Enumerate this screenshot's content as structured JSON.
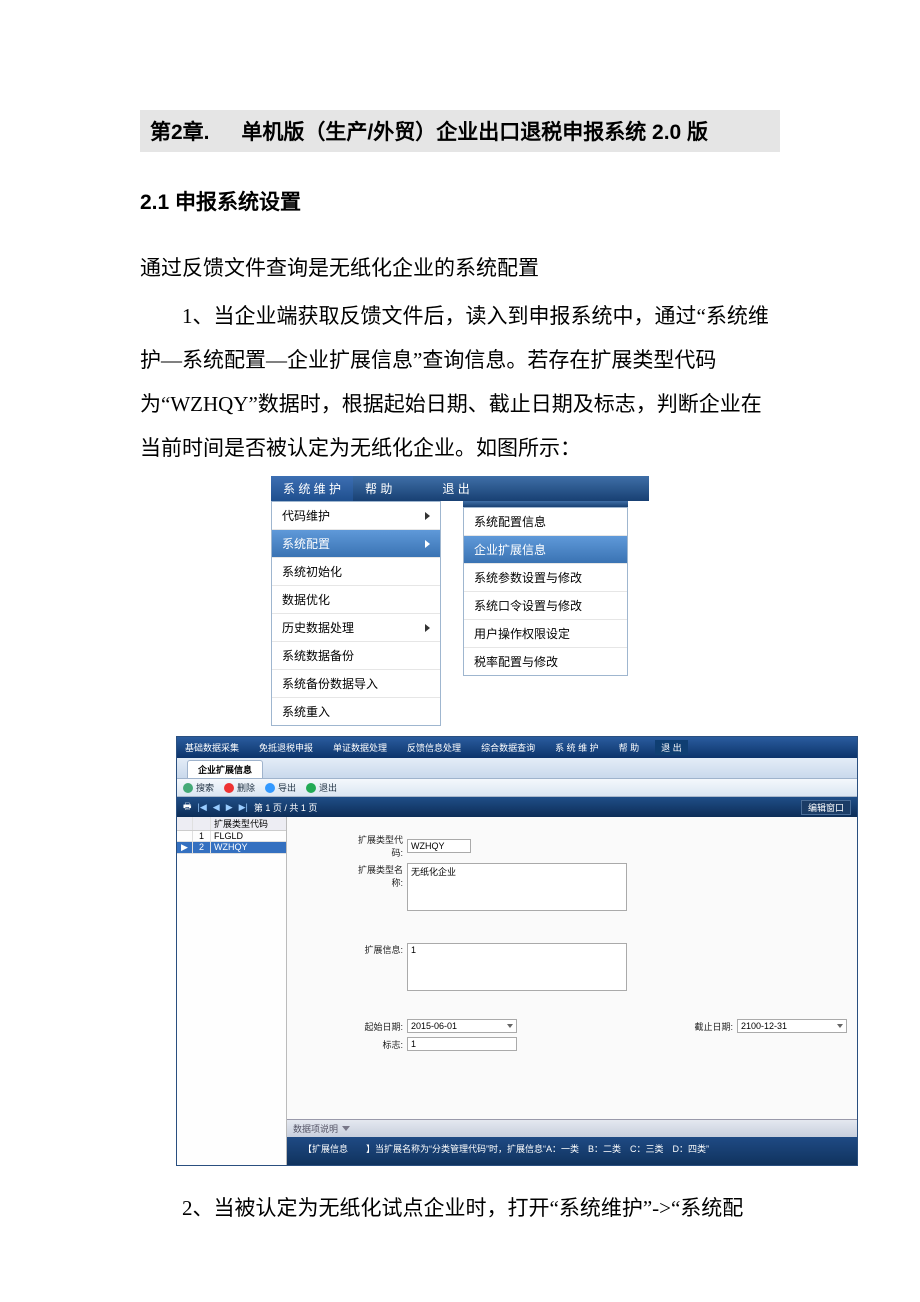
{
  "chapter": {
    "num": "第2章.",
    "title": "单机版（生产/外贸）企业出口退税申报系统 2.0 版"
  },
  "section": {
    "num": "2.1",
    "title": "申报系统设置"
  },
  "para0": "通过反馈文件查询是无纸化企业的系统配置",
  "para1": "1、当企业端获取反馈文件后，读入到申报系统中，通过“系统维护—系统配置—企业扩展信息”查询信息。若存在扩展类型代码为“WZHQY”数据时，根据起始日期、截止日期及标志，判断企业在当前时间是否被认定为无纸化企业。如图所示：",
  "para2": "2、当被认定为无纸化试点企业时，打开“系统维护”->“系统配",
  "menu1": {
    "bar": {
      "m1": "系 统 维 护",
      "m2": "帮  助",
      "m3": "退  出"
    },
    "col1": [
      "代码维护",
      "系统配置",
      "系统初始化",
      "数据优化",
      "历史数据处理",
      "系统数据备份",
      "系统备份数据导入",
      "系统重入"
    ],
    "col2": [
      "系统配置信息",
      "企业扩展信息",
      "系统参数设置与修改",
      "系统口令设置与修改",
      "用户操作权限设定",
      "税率配置与修改"
    ]
  },
  "win": {
    "menubar": [
      "基础数据采集",
      "免抵退税申报",
      "单证数据处理",
      "反馈信息处理",
      "综合数据查询",
      "系 统 维 护",
      "帮  助",
      "退  出"
    ],
    "tab": "企业扩展信息",
    "toolbar": {
      "search": "搜索",
      "del": "删除",
      "exp": "导出",
      "exit": "退出"
    },
    "pager": {
      "txt": "第 1 页 / 共 1 页",
      "edit": "编辑窗口"
    },
    "grid": {
      "head": {
        "n": "",
        "v": "扩展类型代码"
      },
      "rows": [
        {
          "n": "1",
          "v": "FLGLD"
        },
        {
          "n": "2",
          "v": "WZHQY"
        }
      ]
    },
    "form": {
      "code_label": "扩展类型代码:",
      "code": "WZHQY",
      "name_label": "扩展类型名称:",
      "name": "无纸化企业",
      "info_label": "扩展信息:",
      "info": "1",
      "sdate_label": "起始日期:",
      "sdate": "2015-06-01",
      "edate_label": "截止日期:",
      "edate": "2100-12-31",
      "flag_label": "标志:",
      "flag": "1"
    },
    "desc": {
      "label": "数据项说明",
      "text": "【扩展信息　　】当扩展名称为“分类管理代码”时，扩展信息“A：一类　B：二类　C：三类　D：四类”"
    }
  }
}
